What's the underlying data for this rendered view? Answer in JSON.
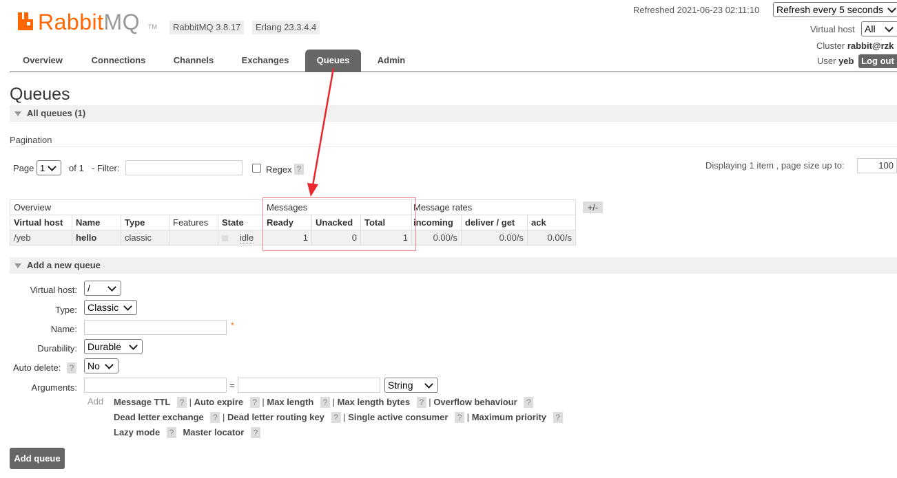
{
  "header": {
    "logo_word": "Rabbit",
    "logo_word_mq": "MQ",
    "logo_tm": "TM",
    "version": "RabbitMQ 3.8.17",
    "erlang": "Erlang 23.3.4.4",
    "refreshed": "Refreshed 2021-06-23 02:11:10",
    "refresh_select": "Refresh every 5 seconds",
    "vhost_label": "Virtual host",
    "vhost_value": "All",
    "cluster_label": "Cluster",
    "cluster_value": "rabbit@rzk",
    "user_label": "User",
    "user_value": "yeb",
    "logout": "Log out",
    "brand_color": "#ff6600"
  },
  "nav": {
    "tabs": [
      "Overview",
      "Connections",
      "Channels",
      "Exchanges",
      "Queues",
      "Admin"
    ],
    "active": "Queues"
  },
  "page": {
    "title": "Queues",
    "all_queues": "All queues (1)",
    "pagination": "Pagination",
    "page_label": "Page",
    "page_value": "1",
    "of_label": "of 1",
    "filter_label": "- Filter:",
    "regex_label": "Regex",
    "help": "?",
    "displaying": "Displaying 1 item , page size up to:",
    "page_size": "100"
  },
  "table": {
    "groups": [
      "Overview",
      "Messages",
      "Message rates"
    ],
    "plus_minus": "+/-",
    "columns": [
      "Virtual host",
      "Name",
      "Type",
      "Features",
      "State",
      "Ready",
      "Unacked",
      "Total",
      "incoming",
      "deliver / get",
      "ack"
    ],
    "rows": [
      {
        "vhost": "/yeb",
        "name": "hello",
        "type": "classic",
        "features": "",
        "state": "idle",
        "ready": "1",
        "unacked": "0",
        "total": "1",
        "incoming": "0.00/s",
        "deliver": "0.00/s",
        "ack": "0.00/s"
      }
    ]
  },
  "add_queue": {
    "heading": "Add a new queue",
    "vhost_label": "Virtual host:",
    "vhost_value": "/",
    "type_label": "Type:",
    "type_value": "Classic",
    "name_label": "Name:",
    "required_mark": "*",
    "durability_label": "Durability:",
    "durability_value": "Durable",
    "autodelete_label": "Auto delete:",
    "autodelete_value": "No",
    "arguments_label": "Arguments:",
    "equals": "=",
    "arg_type": "String",
    "add_label": "Add",
    "arg_links_row1": [
      "Message TTL",
      "Auto expire",
      "Max length",
      "Max length bytes",
      "Overflow behaviour"
    ],
    "arg_links_row2": [
      "Dead letter exchange",
      "Dead letter routing key",
      "Single active consumer",
      "Maximum priority"
    ],
    "arg_links_row3": [
      "Lazy mode",
      "Master locator"
    ],
    "separator": "|",
    "button": "Add queue"
  }
}
